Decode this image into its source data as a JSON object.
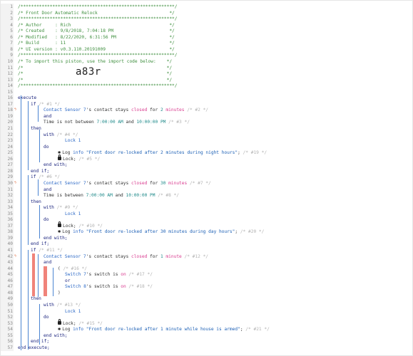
{
  "piston_code": "a83r",
  "header": {
    "banner": "/***********************************************************/",
    "title": "/* Front Door Automatic Relock                             */",
    "author": "/* Author     : Rich                                       */",
    "created": "/* Created    : 9/8/2018, 7:04:18 PM                       */",
    "modified": "/* Modified   : 8/22/2020, 6:31:56 PM                      */",
    "build": "/* Build      : 11                                         */",
    "ui": "/* UI version : v0.3.110.20191009                           */",
    "import": "/* To import this piston, use the import code below:       */",
    "blank": "/*                                                        */"
  },
  "lines": [
    {
      "n": "1",
      "indent": 0,
      "parts": [
        [
          "c-comment",
          "/**********************************************************/"
        ]
      ]
    },
    {
      "n": "2",
      "indent": 0,
      "parts": [
        [
          "c-comment",
          "/* Front Door Automatic Relock                           */"
        ]
      ]
    },
    {
      "n": "3",
      "indent": 0,
      "parts": [
        [
          "c-comment",
          "/**********************************************************/"
        ]
      ]
    },
    {
      "n": "4",
      "indent": 0,
      "parts": [
        [
          "c-comment",
          "/* Author     : Rich                                     */"
        ]
      ]
    },
    {
      "n": "5",
      "indent": 0,
      "parts": [
        [
          "c-comment",
          "/* Created    : 9/8/2018, 7:04:18 PM                     */"
        ]
      ]
    },
    {
      "n": "6",
      "indent": 0,
      "parts": [
        [
          "c-comment",
          "/* Modified   : 8/22/2020, 6:31:56 PM                    */"
        ]
      ]
    },
    {
      "n": "7",
      "indent": 0,
      "parts": [
        [
          "c-comment",
          "/* Build      : 11                                       */"
        ]
      ]
    },
    {
      "n": "8",
      "indent": 0,
      "parts": [
        [
          "c-comment",
          "/* UI version : v0.3.110.20191009                        */"
        ]
      ]
    },
    {
      "n": "9",
      "indent": 0,
      "parts": [
        [
          "c-comment",
          "/**********************************************************/"
        ]
      ]
    },
    {
      "n": "10",
      "indent": 0,
      "parts": [
        [
          "c-comment",
          "/* To import this piston, use the import code below:    */"
        ]
      ]
    },
    {
      "n": "11",
      "indent": 0,
      "parts": [
        [
          "c-comment",
          "/*                                                      */"
        ]
      ]
    },
    {
      "n": "12",
      "indent": 0,
      "parts": [
        [
          "c-comment",
          "/*                                                      */"
        ]
      ]
    },
    {
      "n": "13",
      "indent": 0,
      "parts": [
        [
          "c-comment",
          "/*                                                      */"
        ]
      ]
    },
    {
      "n": "14",
      "indent": 0,
      "parts": [
        [
          "c-comment",
          "/**********************************************************/"
        ]
      ]
    },
    {
      "n": "15",
      "indent": 0,
      "parts": []
    },
    {
      "n": "16",
      "indent": 0,
      "parts": [
        [
          "c-kw",
          "execute"
        ]
      ]
    },
    {
      "n": "17",
      "indent": 18,
      "parts": [
        [
          "c-kw",
          "if "
        ],
        [
          "c-grey",
          "/* #1 */"
        ]
      ]
    },
    {
      "n": "18",
      "indent": 36,
      "trig": true,
      "parts": [
        [
          "c-dev",
          "Contact Sensor 7"
        ],
        [
          "c-plain",
          "'s contact stays "
        ],
        [
          "c-val",
          "closed"
        ],
        [
          "c-plain",
          " for "
        ],
        [
          "c-num",
          "2"
        ],
        [
          "c-plain",
          " "
        ],
        [
          "c-val",
          "minutes"
        ],
        [
          "c-grey",
          " /* #2 */"
        ]
      ]
    },
    {
      "n": "19",
      "indent": 36,
      "parts": [
        [
          "c-kw",
          "and"
        ]
      ]
    },
    {
      "n": "20",
      "indent": 36,
      "parts": [
        [
          "c-plain",
          "Time is not between "
        ],
        [
          "c-num",
          "7:00:00 AM"
        ],
        [
          "c-plain",
          " and "
        ],
        [
          "c-num",
          "10:00:00 PM"
        ],
        [
          "c-grey",
          " /* #3 */"
        ]
      ]
    },
    {
      "n": "21",
      "indent": 18,
      "parts": [
        [
          "c-kw",
          "then"
        ]
      ]
    },
    {
      "n": "22",
      "indent": 36,
      "parts": [
        [
          "c-kw",
          "with "
        ],
        [
          "c-grey",
          "/* #4 */"
        ]
      ]
    },
    {
      "n": "23",
      "indent": 66,
      "parts": [
        [
          "c-dev",
          "Lock 1"
        ]
      ]
    },
    {
      "n": "24",
      "indent": 36,
      "parts": [
        [
          "c-kw",
          "do"
        ]
      ]
    },
    {
      "n": "25",
      "indent": 56,
      "icon": "bug",
      "parts": [
        [
          "c-plain",
          "Log "
        ],
        [
          "c-dev",
          "info"
        ],
        [
          "c-str",
          " \"Front door re-locked after 2 minutes during night hours\""
        ],
        [
          "c-plain",
          ";"
        ],
        [
          "c-grey",
          " /* #19 */"
        ]
      ]
    },
    {
      "n": "26",
      "indent": 56,
      "icon": "lock",
      "parts": [
        [
          "c-plain",
          "Lock;"
        ],
        [
          "c-grey",
          " /* #5 */"
        ]
      ]
    },
    {
      "n": "27",
      "indent": 36,
      "parts": [
        [
          "c-kw",
          "end with;"
        ]
      ]
    },
    {
      "n": "28",
      "indent": 18,
      "parts": [
        [
          "c-kw",
          "end if;"
        ]
      ]
    },
    {
      "n": "29",
      "indent": 18,
      "parts": [
        [
          "c-kw",
          "if "
        ],
        [
          "c-grey",
          "/* #6 */"
        ]
      ]
    },
    {
      "n": "30",
      "indent": 36,
      "trig": true,
      "parts": [
        [
          "c-dev",
          "Contact Sensor 7"
        ],
        [
          "c-plain",
          "'s contact stays "
        ],
        [
          "c-val",
          "closed"
        ],
        [
          "c-plain",
          " for "
        ],
        [
          "c-num",
          "30"
        ],
        [
          "c-plain",
          " "
        ],
        [
          "c-val",
          "minutes"
        ],
        [
          "c-grey",
          " /* #7 */"
        ]
      ]
    },
    {
      "n": "31",
      "indent": 36,
      "parts": [
        [
          "c-kw",
          "and"
        ]
      ]
    },
    {
      "n": "32",
      "indent": 36,
      "parts": [
        [
          "c-plain",
          "Time is between "
        ],
        [
          "c-num",
          "7:00:00 AM"
        ],
        [
          "c-plain",
          " and "
        ],
        [
          "c-num",
          "10:00:00 PM"
        ],
        [
          "c-grey",
          " /* #8 */"
        ]
      ]
    },
    {
      "n": "33",
      "indent": 18,
      "parts": [
        [
          "c-kw",
          "then"
        ]
      ]
    },
    {
      "n": "34",
      "indent": 36,
      "parts": [
        [
          "c-kw",
          "with "
        ],
        [
          "c-grey",
          "/* #9 */"
        ]
      ]
    },
    {
      "n": "35",
      "indent": 66,
      "parts": [
        [
          "c-dev",
          "Lock 1"
        ]
      ]
    },
    {
      "n": "36",
      "indent": 36,
      "parts": [
        [
          "c-kw",
          "do"
        ]
      ]
    },
    {
      "n": "37",
      "indent": 56,
      "icon": "lock",
      "parts": [
        [
          "c-plain",
          "Lock;"
        ],
        [
          "c-grey",
          " /* #10 */"
        ]
      ]
    },
    {
      "n": "38",
      "indent": 56,
      "icon": "bug",
      "parts": [
        [
          "c-plain",
          "Log "
        ],
        [
          "c-dev",
          "info"
        ],
        [
          "c-str",
          " \"Front door re-locked after 30 minutes during day hours\""
        ],
        [
          "c-plain",
          ";"
        ],
        [
          "c-grey",
          " /* #20 */"
        ]
      ]
    },
    {
      "n": "39",
      "indent": 36,
      "parts": [
        [
          "c-kw",
          "end with;"
        ]
      ]
    },
    {
      "n": "40",
      "indent": 18,
      "parts": [
        [
          "c-kw",
          "end if;"
        ]
      ]
    },
    {
      "n": "41",
      "indent": 18,
      "parts": [
        [
          "c-kw",
          "if "
        ],
        [
          "c-grey",
          "/* #11 */"
        ]
      ]
    },
    {
      "n": "42",
      "indent": 36,
      "trig": true,
      "parts": [
        [
          "c-dev",
          "Contact Sensor 7"
        ],
        [
          "c-plain",
          "'s contact stays "
        ],
        [
          "c-val",
          "closed"
        ],
        [
          "c-plain",
          " for "
        ],
        [
          "c-num",
          "1"
        ],
        [
          "c-plain",
          " "
        ],
        [
          "c-val",
          "minute"
        ],
        [
          "c-grey",
          " /* #12 */"
        ]
      ]
    },
    {
      "n": "43",
      "indent": 36,
      "parts": [
        [
          "c-kw",
          "and"
        ]
      ]
    },
    {
      "n": "44",
      "indent": 56,
      "parts": [
        [
          "c-plain",
          "( "
        ],
        [
          "c-grey",
          "/* #16 */"
        ]
      ]
    },
    {
      "n": "45",
      "indent": 66,
      "parts": [
        [
          "c-dev",
          "Switch 7"
        ],
        [
          "c-plain",
          "'s switch is "
        ],
        [
          "c-val",
          "on"
        ],
        [
          "c-grey",
          " /* #17 */"
        ]
      ]
    },
    {
      "n": "46",
      "indent": 66,
      "parts": [
        [
          "c-kw",
          "or"
        ]
      ]
    },
    {
      "n": "47",
      "indent": 66,
      "parts": [
        [
          "c-dev",
          "Switch 8"
        ],
        [
          "c-plain",
          "'s switch is "
        ],
        [
          "c-val",
          "on"
        ],
        [
          "c-grey",
          " /* #18 */"
        ]
      ]
    },
    {
      "n": "48",
      "indent": 56,
      "parts": [
        [
          "c-plain",
          ")"
        ]
      ]
    },
    {
      "n": "49",
      "indent": 18,
      "parts": [
        [
          "c-kw",
          "then"
        ]
      ]
    },
    {
      "n": "50",
      "indent": 36,
      "parts": [
        [
          "c-kw",
          "with "
        ],
        [
          "c-grey",
          "/* #13 */"
        ]
      ]
    },
    {
      "n": "51",
      "indent": 66,
      "parts": [
        [
          "c-dev",
          "Lock 1"
        ]
      ]
    },
    {
      "n": "52",
      "indent": 36,
      "parts": [
        [
          "c-kw",
          "do"
        ]
      ]
    },
    {
      "n": "53",
      "indent": 56,
      "icon": "lock",
      "parts": [
        [
          "c-plain",
          "Lock;"
        ],
        [
          "c-grey",
          " /* #15 */"
        ]
      ]
    },
    {
      "n": "54",
      "indent": 56,
      "icon": "bug",
      "parts": [
        [
          "c-plain",
          "Log "
        ],
        [
          "c-dev",
          "info"
        ],
        [
          "c-str",
          " \"Front door re-locked after 1 minute while house is armed\""
        ],
        [
          "c-plain",
          ";"
        ],
        [
          "c-grey",
          " /* #21 */"
        ]
      ]
    },
    {
      "n": "55",
      "indent": 36,
      "parts": [
        [
          "c-kw",
          "end with;"
        ]
      ]
    },
    {
      "n": "56",
      "indent": 18,
      "parts": [
        [
          "c-kw",
          "end if;"
        ]
      ]
    },
    {
      "n": "57",
      "indent": 0,
      "parts": [
        [
          "c-kw",
          "end execute;"
        ]
      ]
    }
  ]
}
